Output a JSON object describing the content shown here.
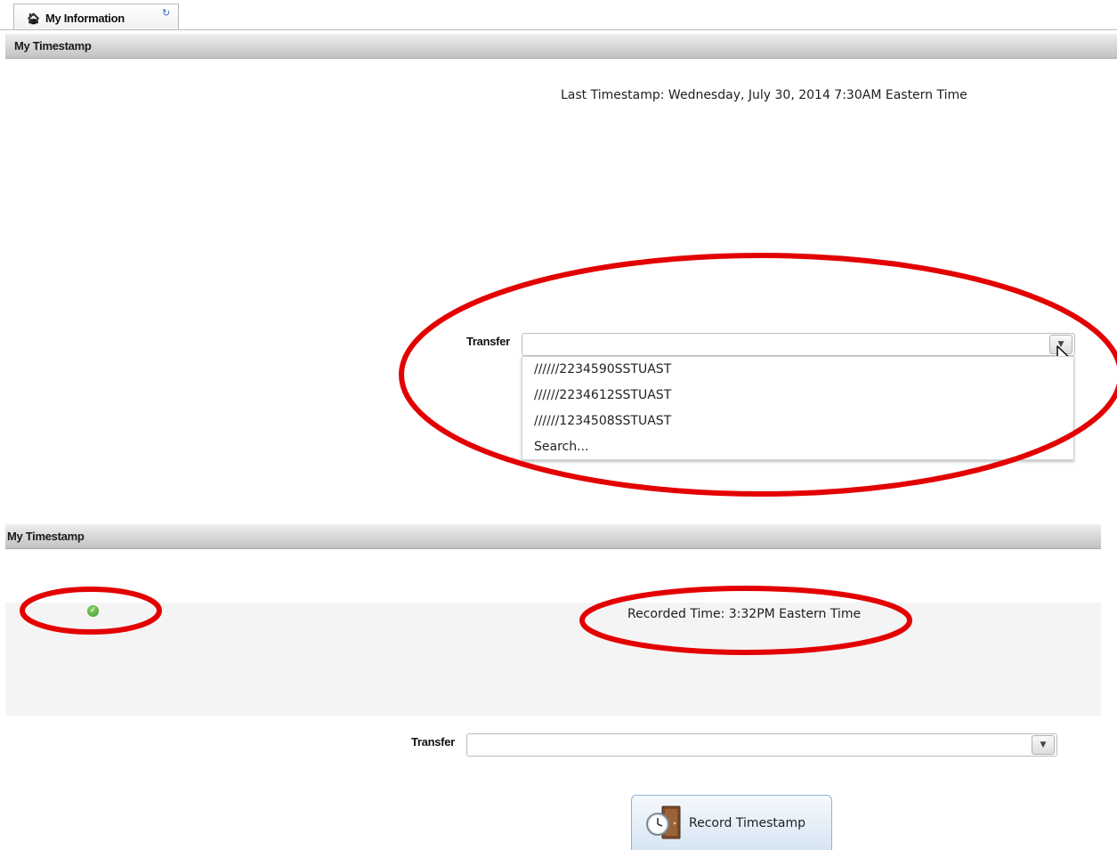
{
  "tab": {
    "label": "My Information"
  },
  "top_section": {
    "header": "My Timestamp",
    "last_timestamp": "Last Timestamp: Wednesday, July 30, 2014 7:30AM  Eastern Time",
    "transfer_label": "Transfer",
    "transfer_value": "",
    "dropdown_options": [
      "//////2234590SSTUAST",
      "//////2234612SSTUAST",
      "//////1234508SSTUAST",
      "Search..."
    ]
  },
  "bottom_section": {
    "header": "My Timestamp",
    "recorded_time": "Recorded Time: 3:32PM  Eastern Time",
    "transfer_label": "Transfer",
    "transfer_value": "",
    "record_button_label": "Record Timestamp"
  },
  "colors": {
    "annotation": "#e30000",
    "success": "#4caf3a",
    "button_border": "#8fb1d6"
  },
  "icons": {
    "tab_home": "home-icon",
    "tab_refresh": "refresh-icon",
    "status": "check-circle-icon",
    "combo_arrow": "caret-down-icon",
    "record": "clock-door-icon"
  }
}
